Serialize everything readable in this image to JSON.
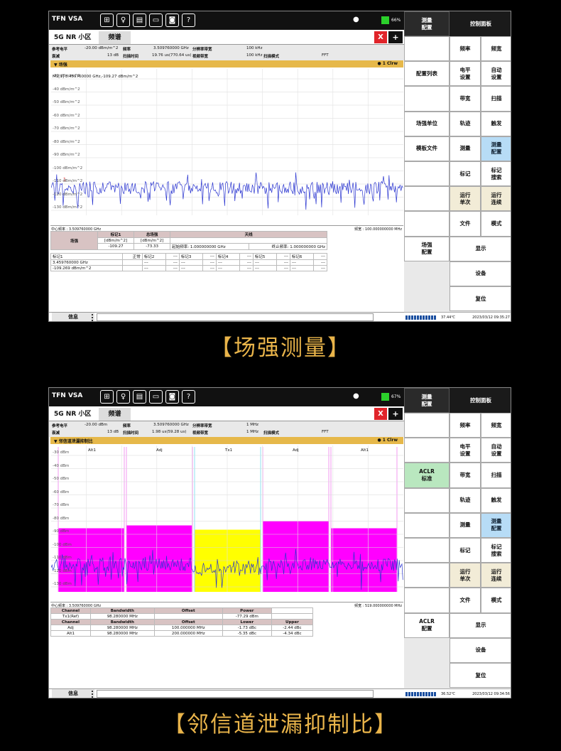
{
  "app_title": "TFN VSA",
  "toolbar_icons": [
    {
      "name": "windows-icon",
      "glyph": "⊞"
    },
    {
      "name": "bulb-icon",
      "glyph": "♀"
    },
    {
      "name": "folder-icon",
      "glyph": "▤"
    },
    {
      "name": "save-icon",
      "glyph": "▭"
    },
    {
      "name": "camera-icon",
      "glyph": "◙"
    },
    {
      "name": "help-icon",
      "glyph": "?"
    }
  ],
  "screens": [
    {
      "battery": "66%",
      "tab_left": "5G NR 小区",
      "tab_active": "频谱",
      "close_label": "X",
      "add_label": "+",
      "params": [
        {
          "label": "参考电平",
          "value": "-20.00 dBm/m^2"
        },
        {
          "label": "频率",
          "value": "3.509760000 GHz"
        },
        {
          "label": "分辨率带宽",
          "value": "100 kHz"
        },
        {
          "label": "衰减",
          "value": "13 dB"
        },
        {
          "label": "扫描时间",
          "value": "19.76 us(770.64 us)"
        },
        {
          "label": "视频带宽",
          "value": "100 kHz"
        },
        {
          "label": "扫描模式",
          "value": "FFT"
        }
      ],
      "panel_title": "▼ 场强",
      "panel_right": "● 1 Clrw",
      "marker_readout": "M1[1]    3.459760000 GHz,-109.27 dBm/m^2",
      "y_labels": [
        "-30 dBm/m^2",
        "-40 dBm/m^2",
        "-50 dBm/m^2",
        "-60 dBm/m^2",
        "-70 dBm/m^2",
        "-80 dBm/m^2",
        "-90 dBm/m^2",
        "-100 dBm/m^2",
        "-110 dBm/m^2",
        "-120 dBm/m^2",
        "-130 dBm/m^2"
      ],
      "channel_labels": [],
      "center_freq": "中心频率 : 3.509760000 GHz",
      "span": "频宽 : 100.000000000 MHz",
      "info_label": "信息",
      "temp": "37.44℃",
      "datetime": "2023/03/12 09:35:27",
      "side_left_header": "测量\n配置",
      "side_right_header": "控制面板",
      "side_left": [
        {
          "label": ""
        },
        {
          "label": "配置列表"
        },
        {
          "label": ""
        },
        {
          "label": "场强单位"
        },
        {
          "label": "模板文件"
        },
        {
          "label": ""
        },
        {
          "label": ""
        },
        {
          "label": ""
        },
        {
          "label": "场强\n配置"
        }
      ],
      "side_right": [
        {
          "a": "频率",
          "b": "频宽"
        },
        {
          "a": "电平\n设置",
          "b": "自动\n设置"
        },
        {
          "a": "带宽",
          "b": "扫描"
        },
        {
          "a": "轨迹",
          "b": "触发"
        },
        {
          "a": "测量",
          "b": "测量\n配置",
          "b_blue": true
        },
        {
          "a": "标记",
          "b": "标记\n搜索"
        },
        {
          "a": "运行\n单次",
          "b": "运行\n连续",
          "beige": true
        },
        {
          "a": "文件",
          "b": "模式"
        }
      ],
      "side_bottom": [
        "显示",
        "设备",
        "复位"
      ],
      "result_table": {
        "rows": [
          [
            "场强",
            "标记1",
            "总场强",
            "天线"
          ],
          [
            "",
            "[dBm/m^2]",
            "[dBm/m^2]",
            ""
          ],
          [
            "",
            "-109.27",
            "-73.33",
            "起始频率: 1.000000000 GHz",
            "终止频率: 1.000000000 GHz"
          ]
        ],
        "markers": [
          [
            "标记1",
            "正常",
            "标记2",
            "---",
            "标记3",
            "---",
            "标记4",
            "---",
            "标记5",
            "---",
            "标记6",
            "---"
          ],
          [
            "3.459760000 GHz",
            "",
            "---",
            "---",
            "---",
            "---",
            "---",
            "---",
            "---",
            "---",
            "---",
            "---"
          ],
          [
            "-109.269 dBm/m^2",
            "",
            "---",
            "---",
            "---",
            "---",
            "---",
            "---",
            "---",
            "---",
            "---",
            "---"
          ]
        ]
      }
    },
    {
      "battery": "67%",
      "tab_left": "5G NR 小区",
      "tab_active": "频谱",
      "close_label": "X",
      "add_label": "+",
      "params": [
        {
          "label": "参考电平",
          "value": "-20.00 dBm"
        },
        {
          "label": "频率",
          "value": "3.509760000 GHz"
        },
        {
          "label": "分辨率带宽",
          "value": "1 MHz"
        },
        {
          "label": "衰减",
          "value": "13 dB"
        },
        {
          "label": "扫描时间",
          "value": "1.98 us(59.28 us)"
        },
        {
          "label": "视频带宽",
          "value": "1 MHz"
        },
        {
          "label": "扫描模式",
          "value": "FFT"
        }
      ],
      "panel_title": "▼ 邻信道泄漏抑制比",
      "panel_right": "● 1 Clrw",
      "marker_readout": "",
      "y_labels": [
        "-30 dBm",
        "-40 dBm",
        "-50 dBm",
        "-60 dBm",
        "-70 dBm",
        "-80 dBm",
        "-90 dBm",
        "-100 dBm",
        "-110 dBm",
        "-120 dBm",
        "-130 dBm"
      ],
      "channel_labels": [
        "Alt1",
        "Adj",
        "Tx1",
        "Adj",
        "Alt1"
      ],
      "center_freq": "中心频率 : 3.509760000 GHz",
      "span": "频宽 : 519.000000000 MHz",
      "info_label": "信息",
      "temp": "36.52℃",
      "datetime": "2023/03/12 09:34:56",
      "side_left_header": "测量\n配置",
      "side_right_header": "控制面板",
      "side_left": [
        {
          "label": ""
        },
        {
          "label": ""
        },
        {
          "label": "ACLR\n标准",
          "green": true
        },
        {
          "label": ""
        },
        {
          "label": ""
        },
        {
          "label": ""
        },
        {
          "label": ""
        },
        {
          "label": ""
        },
        {
          "label": "ACLR\n配置"
        }
      ],
      "side_right": [
        {
          "a": "频率",
          "b": "频宽"
        },
        {
          "a": "电平\n设置",
          "b": "自动\n设置"
        },
        {
          "a": "带宽",
          "b": "扫描"
        },
        {
          "a": "轨迹",
          "b": "触发"
        },
        {
          "a": "测量",
          "b": "测量\n配置",
          "b_blue": true
        },
        {
          "a": "标记",
          "b": "标记\n搜索"
        },
        {
          "a": "运行\n单次",
          "b": "运行\n连续",
          "beige": true
        },
        {
          "a": "文件",
          "b": "模式"
        }
      ],
      "side_bottom": [
        "显示",
        "设备",
        "复位"
      ],
      "aclr_table": {
        "head1": [
          "Channel",
          "Bandwidth",
          "Offset",
          "Power"
        ],
        "row1": [
          "Tx1(Ref)",
          "98.280000 MHz",
          "",
          "-77.29 dBm"
        ],
        "head2": [
          "Channel",
          "Bandwidth",
          "Offset",
          "Lower",
          "Upper"
        ],
        "rows": [
          [
            "Adj",
            "98.280000 MHz",
            "100.000000 MHz",
            "-1.73 dBc",
            "-2.44 dBc"
          ],
          [
            "Alt1",
            "98.280000 MHz",
            "200.000000 MHz",
            "-5.35 dBc",
            "-4.34 dBc"
          ]
        ]
      }
    }
  ],
  "captions": [
    "【场强测量】",
    "【邻信道泄漏抑制比】"
  ],
  "colors": {
    "accent": "#e6b84a",
    "trace": "#2a35d0",
    "adj_band": "#ff00ff",
    "tx_band": "#ffff00"
  }
}
